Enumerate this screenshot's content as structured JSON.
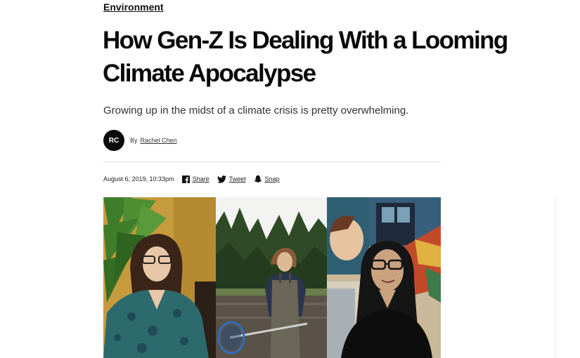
{
  "section": {
    "label": "Environment"
  },
  "article": {
    "title": "How Gen-Z Is Dealing With a Looming Climate Apocalypse",
    "subtitle": "Growing up in the midst of a climate crisis is pretty overwhelming.",
    "author": {
      "initials": "RC",
      "by": "By",
      "name": "Rachel Chen"
    },
    "timestamp": "August 6, 2019, 10:33pm"
  },
  "share": {
    "facebook": {
      "label": "Share",
      "icon": "facebook-icon"
    },
    "twitter": {
      "label": "Tweet",
      "icon": "twitter-icon"
    },
    "snapchat": {
      "label": "Snap",
      "icon": "snapchat-icon"
    }
  }
}
